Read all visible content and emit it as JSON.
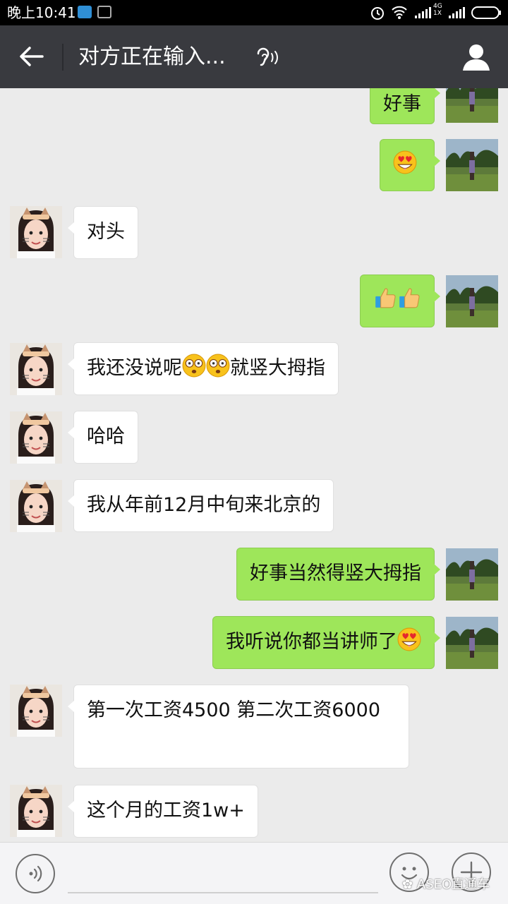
{
  "status_bar": {
    "time": "晚上10:41",
    "network": "4G 1X"
  },
  "header": {
    "title": "对方正在输入...",
    "back_icon": "back-arrow-icon",
    "ear_icon": "earpiece-icon",
    "profile_icon": "profile-icon"
  },
  "messages": [
    {
      "side": "right",
      "text": "好事"
    },
    {
      "side": "right",
      "emojis": [
        "heart-eyes-emoji"
      ]
    },
    {
      "side": "left",
      "text": "对头"
    },
    {
      "side": "right",
      "emojis": [
        "thumbs-up-emoji",
        "thumbs-up-emoji"
      ]
    },
    {
      "side": "left",
      "text_before": "我还没说呢",
      "emojis": [
        "shocked-emoji",
        "shocked-emoji"
      ],
      "text_after": "就竖大拇指"
    },
    {
      "side": "left",
      "text": "哈哈"
    },
    {
      "side": "left",
      "text": "我从年前12月中旬来北京的"
    },
    {
      "side": "right",
      "text": "好事当然得竖大拇指"
    },
    {
      "side": "right",
      "text": "我听说你都当讲师了",
      "emojis": [
        "heart-eyes-emoji"
      ]
    },
    {
      "side": "left",
      "text": "第一次工资4500 第二次工资6000"
    },
    {
      "side": "left",
      "text": "这个月的工资1w+"
    }
  ],
  "input_bar": {
    "voice_icon": "voice-icon",
    "emoji_icon": "emoji-icon",
    "more_icon": "add-icon"
  },
  "watermark": "ASEO直通车",
  "colors": {
    "sent_bubble": "#9ee65a",
    "received_bubble": "#ffffff",
    "header": "#393a3f",
    "background": "#ebebeb"
  }
}
